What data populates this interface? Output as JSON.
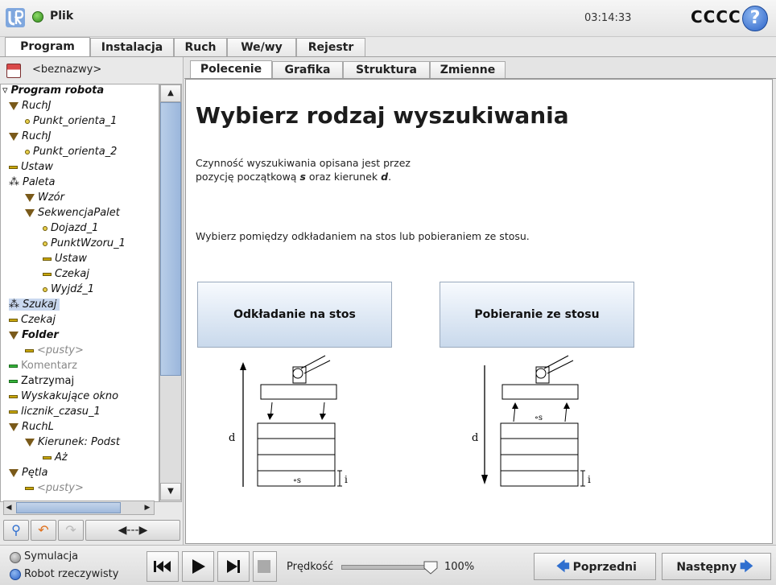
{
  "header": {
    "file_label": "Plik",
    "clock": "03:14:33",
    "robot_name": "CCCC",
    "help_glyph": "?"
  },
  "main_tabs": [
    "Program",
    "Instalacja",
    "Ruch",
    "We/wy",
    "Rejestr"
  ],
  "sub_tabs": [
    "Polecenie",
    "Grafika",
    "Struktura",
    "Zmienne"
  ],
  "program_name": "<beznazwy>",
  "tree": [
    {
      "label": "Program robota",
      "icon": "none",
      "bold": true
    },
    {
      "label": "RuchJ",
      "icon": "triangle"
    },
    {
      "label": "Punkt_orienta_1",
      "icon": "waypoint"
    },
    {
      "label": "RuchJ",
      "icon": "triangle"
    },
    {
      "label": "Punkt_orienta_2",
      "icon": "waypoint"
    },
    {
      "label": "Ustaw",
      "icon": "bar"
    },
    {
      "label": "Paleta",
      "icon": "pallet"
    },
    {
      "label": "Wzór",
      "icon": "triangle"
    },
    {
      "label": "SekwencjaPalet",
      "icon": "triangle"
    },
    {
      "label": "Dojazd_1",
      "icon": "waypoint"
    },
    {
      "label": "PunktWzoru_1",
      "icon": "waypoint"
    },
    {
      "label": "Ustaw",
      "icon": "bar"
    },
    {
      "label": "Czekaj",
      "icon": "bar"
    },
    {
      "label": "Wyjdź_1",
      "icon": "waypoint"
    },
    {
      "label": "Szukaj",
      "icon": "pallet",
      "selected": true
    },
    {
      "label": "Czekaj",
      "icon": "bar"
    },
    {
      "label": "Folder",
      "icon": "triangle",
      "bold": true
    },
    {
      "label": "<pusty>",
      "icon": "bar",
      "grey": true
    },
    {
      "label": "Komentarz",
      "icon": "bar-green",
      "grey": true
    },
    {
      "label": "Zatrzymaj",
      "icon": "bar-green"
    },
    {
      "label": "Wyskakujące okno",
      "icon": "bar"
    },
    {
      "label": "licznik_czasu_1",
      "icon": "bar"
    },
    {
      "label": "RuchL",
      "icon": "triangle"
    },
    {
      "label": "Kierunek: Podst",
      "icon": "triangle"
    },
    {
      "label": "Aż",
      "icon": "bar"
    },
    {
      "label": "Pętla",
      "icon": "triangle"
    },
    {
      "label": "<pusty>",
      "icon": "bar",
      "grey": true
    }
  ],
  "content": {
    "heading": "Wybierz rodzaj wyszukiwania",
    "desc1_line1": "Czynność wyszukiwania opisana jest przez",
    "desc1_line2_a": "pozycję początkową ",
    "desc1_line2_s": "s",
    "desc1_line2_b": " oraz kierunek ",
    "desc1_line2_d": "d",
    "desc1_line2_c": ".",
    "desc2": "Wybierz pomiędzy odkładaniem na stos lub pobieraniem ze stosu.",
    "btn_stack": "Odkładanie na stos",
    "btn_destack": "Pobieranie ze stosu",
    "diagram_d": "d",
    "diagram_s": "∘s",
    "diagram_i": "i"
  },
  "bottom": {
    "mode_sim": "Symulacja",
    "mode_real": "Robot rzeczywisty",
    "speed_label": "Prędkość",
    "speed_value": "100%",
    "speed_fraction": 1.0,
    "prev": "Poprzedni",
    "next": "Następny"
  },
  "colors": {
    "accent_blue": "#2b62c8",
    "selection": "#c9d8ef"
  }
}
